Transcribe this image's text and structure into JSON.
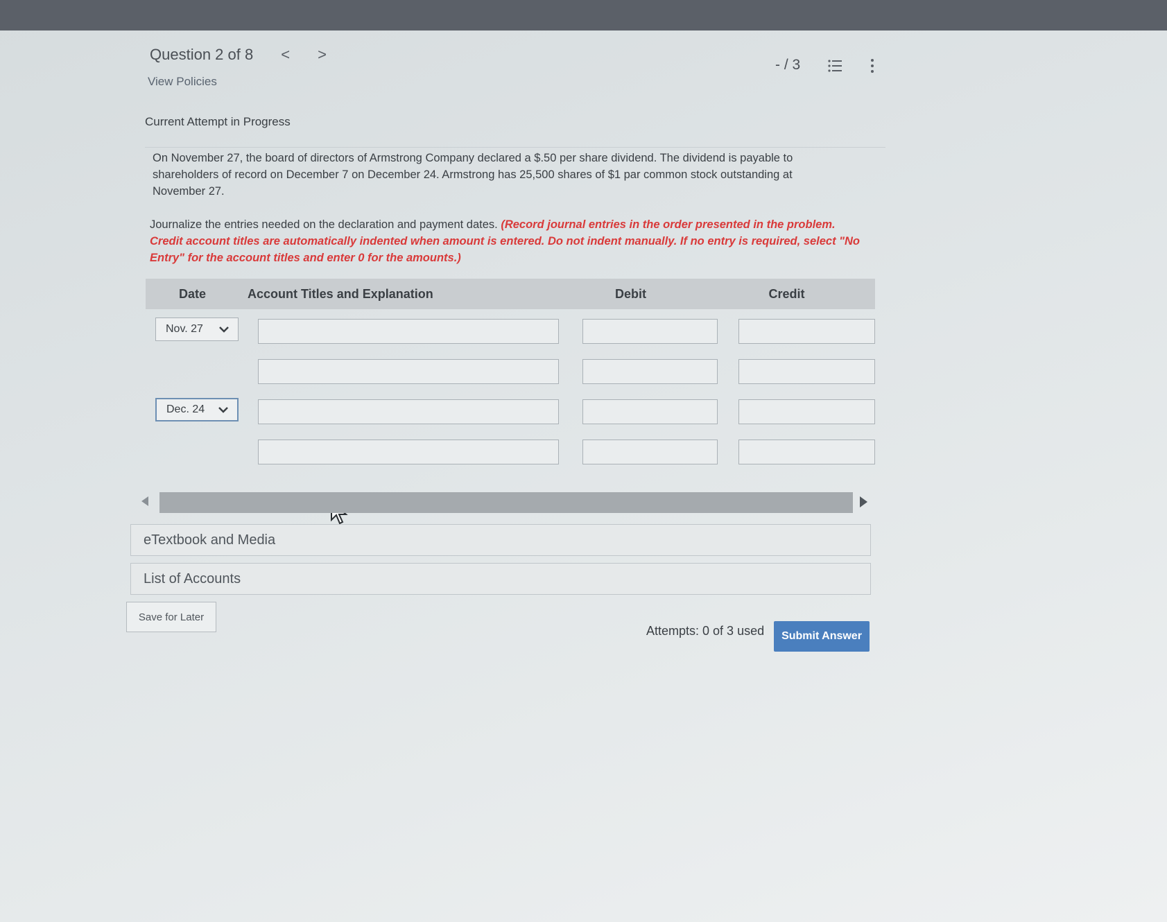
{
  "header": {
    "question_label": "Question 2 of 8",
    "prev_arrow": "<",
    "next_arrow": ">",
    "view_policies": "View Policies",
    "score": "- / 3",
    "list_icon": "list-icon",
    "more_icon": "more-vertical-icon"
  },
  "attempt_status": "Current Attempt in Progress",
  "problem_text": "On November 27, the board of directors of Armstrong Company declared a $.50 per share dividend. The dividend is payable to shareholders of record on December 7 on December 24. Armstrong has 25,500 shares of $1 par common stock outstanding at November 27.",
  "instructions": {
    "plain": "Journalize the entries needed on the declaration and payment dates. ",
    "emphasis": "(Record journal entries in the order presented in the problem. Credit account titles are automatically indented when amount is entered. Do not indent manually. If no entry is required, select \"No Entry\" for the account titles and enter 0 for the amounts.)"
  },
  "journal": {
    "columns": {
      "date": "Date",
      "account": "Account Titles and Explanation",
      "debit": "Debit",
      "credit": "Credit"
    },
    "entries": [
      {
        "date": "Nov. 27"
      },
      {
        "date": "Dec. 24"
      }
    ]
  },
  "panels": {
    "etextbook": "eTextbook and Media",
    "accounts": "List of Accounts"
  },
  "footer": {
    "save_later": "Save for Later",
    "attempts": "Attempts: 0 of 3 used",
    "submit": "Submit Answer"
  },
  "colors": {
    "topbar": "#5b6068",
    "instruction_red": "#d93a3a",
    "submit_blue": "#4a7fbe"
  }
}
